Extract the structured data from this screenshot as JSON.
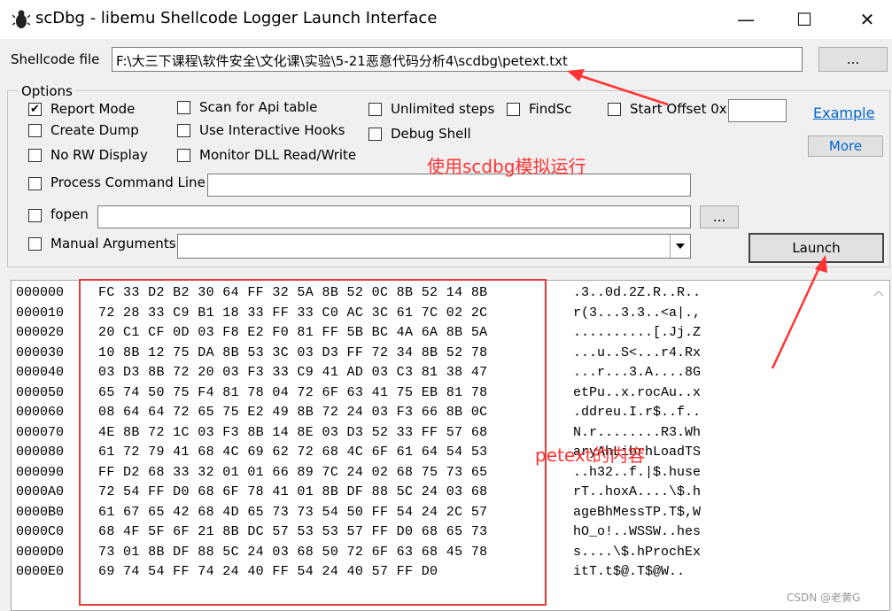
{
  "window": {
    "title": "scDbg - libemu Shellcode Logger Launch Interface",
    "controls": [
      "—",
      "☐",
      "✕"
    ]
  },
  "shellcode": {
    "label": "Shellcode file",
    "path": "F:\\大三下课程\\软件安全\\文化课\\实验\\5-21恶意代码分析4\\scdbg\\petext.txt",
    "browse_label": "..."
  },
  "options": {
    "group_label": "Options",
    "report_mode": {
      "label": "Report Mode",
      "checked": "✔"
    },
    "create_dump": {
      "label": "Create Dump"
    },
    "no_rw_display": {
      "label": "No RW Display"
    },
    "scan_api_table": {
      "label": "Scan for Api table"
    },
    "interactive_hooks": {
      "label": "Use Interactive Hooks"
    },
    "monitor_dll": {
      "label": "Monitor DLL Read/Write"
    },
    "unlimited_steps": {
      "label": "Unlimited steps"
    },
    "debug_shell": {
      "label": "Debug Shell"
    },
    "findsc": {
      "label": "FindSc"
    },
    "start_offset": {
      "label": "Start Offset  0x",
      "value": ""
    },
    "example_link": "Example",
    "more_button": "More",
    "process_cmd_line": {
      "label": "Process Command Line",
      "value": ""
    },
    "fopen": {
      "label": "fopen",
      "value": "",
      "browse_label": "..."
    },
    "manual_args": {
      "label": "Manual  Arguments",
      "value": ""
    },
    "launch_button": "Launch"
  },
  "annotations": {
    "scdbg_note": "使用scdbg模拟运行",
    "petext_note": "petext的内容",
    "watermark": "CSDN @老黄G"
  },
  "hex": {
    "rows": [
      {
        "offset": "000000",
        "bytes": "FC 33 D2 B2 30 64 FF 32 5A 8B 52 0C 8B 52 14 8B",
        "ascii": ".3..0d.2Z.R..R.."
      },
      {
        "offset": "000010",
        "bytes": "72 28 33 C9 B1 18 33 FF 33 C0 AC 3C 61 7C 02 2C",
        "ascii": "r(3...3.3..<a|.,"
      },
      {
        "offset": "000020",
        "bytes": "20 C1 CF 0D 03 F8 E2 F0 81 FF 5B BC 4A 6A 8B 5A",
        "ascii": "..........[.Jj.Z"
      },
      {
        "offset": "000030",
        "bytes": "10 8B 12 75 DA 8B 53 3C 03 D3 FF 72 34 8B 52 78",
        "ascii": "...u..S<...r4.Rx"
      },
      {
        "offset": "000040",
        "bytes": "03 D3 8B 72 20 03 F3 33 C9 41 AD 03 C3 81 38 47",
        "ascii": "...r...3.A....8G"
      },
      {
        "offset": "000050",
        "bytes": "65 74 50 75 F4 81 78 04 72 6F 63 41 75 EB 81 78",
        "ascii": "etPu..x.rocAu..x"
      },
      {
        "offset": "000060",
        "bytes": "08 64 64 72 65 75 E2 49 8B 72 24 03 F3 66 8B 0C",
        "ascii": ".ddreu.I.r$..f.."
      },
      {
        "offset": "000070",
        "bytes": "4E 8B 72 1C 03 F3 8B 14 8E 03 D3 52 33 FF 57 68",
        "ascii": "N.r........R3.Wh"
      },
      {
        "offset": "000080",
        "bytes": "61 72 79 41 68 4C 69 62 72 68 4C 6F 61 64 54 53",
        "ascii": "aryAhLibrhLoadTS"
      },
      {
        "offset": "000090",
        "bytes": "FF D2 68 33 32 01 01 66 89 7C 24 02 68 75 73 65",
        "ascii": "..h32..f.|$.huse"
      },
      {
        "offset": "0000A0",
        "bytes": "72 54 FF D0 68 6F 78 41 01 8B DF 88 5C 24 03 68",
        "ascii": "rT..hoxA....\\$.h"
      },
      {
        "offset": "0000B0",
        "bytes": "61 67 65 42 68 4D 65 73 73 54 50 FF 54 24 2C 57",
        "ascii": "ageBhMessTP.T$,W"
      },
      {
        "offset": "0000C0",
        "bytes": "68 4F 5F 6F 21 8B DC 57 53 53 57 FF D0 68 65 73",
        "ascii": "hO_o!..WSSW..hes"
      },
      {
        "offset": "0000D0",
        "bytes": "73 01 8B DF 88 5C 24 03 68 50 72 6F 63 68 45 78",
        "ascii": "s....\\$.hProchEx"
      },
      {
        "offset": "0000E0",
        "bytes": "69 74 54 FF 74 24 40 FF 54 24 40 57 FF D0",
        "ascii": "itT.t$@.T$@W.."
      }
    ]
  }
}
